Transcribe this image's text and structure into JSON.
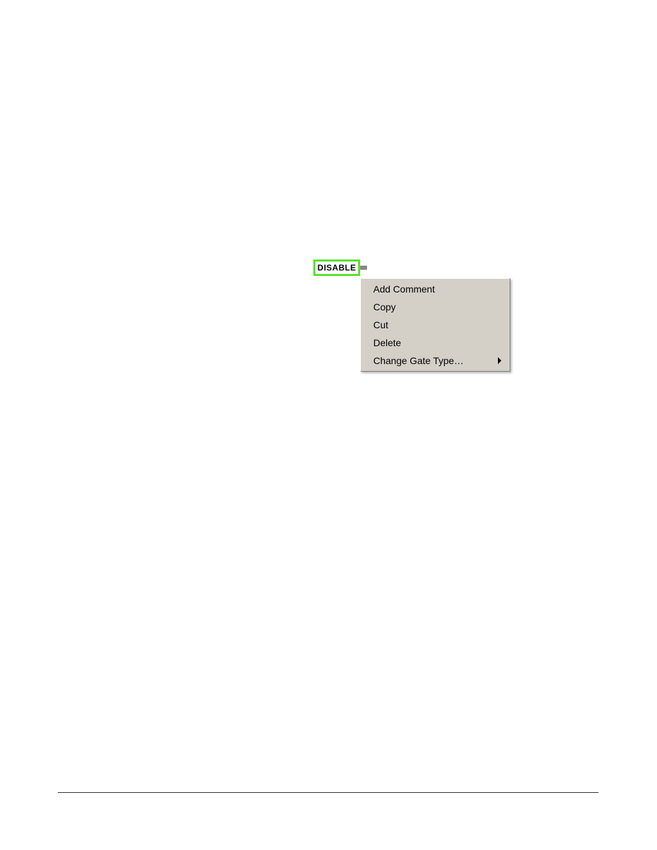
{
  "node": {
    "label": "DISABLE"
  },
  "contextMenu": {
    "items": [
      {
        "label": "Add Comment",
        "hasSubmenu": false
      },
      {
        "label": "Copy",
        "hasSubmenu": false
      },
      {
        "label": "Cut",
        "hasSubmenu": false
      },
      {
        "label": "Delete",
        "hasSubmenu": false
      },
      {
        "label": "Change Gate Type…",
        "hasSubmenu": true
      }
    ]
  }
}
